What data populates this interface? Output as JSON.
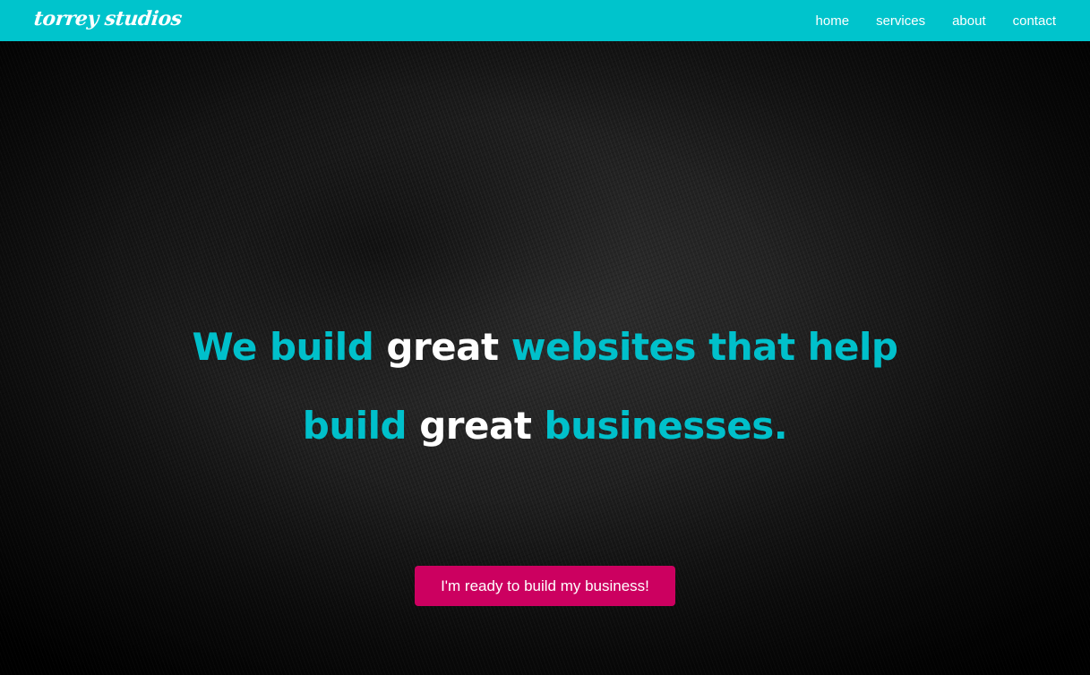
{
  "brand": {
    "logo_text": "torrey studios",
    "accent_color": "#00c4cc",
    "cta_color": "#cc0060"
  },
  "nav": {
    "items": [
      {
        "label": "home"
      },
      {
        "label": "services"
      },
      {
        "label": "about"
      },
      {
        "label": "contact"
      }
    ]
  },
  "hero": {
    "line1": [
      {
        "text": "We build ",
        "color": "cyan"
      },
      {
        "text": "great ",
        "color": "white"
      },
      {
        "text": "websites that help",
        "color": "cyan"
      }
    ],
    "line2": [
      {
        "text": "build ",
        "color": "cyan"
      },
      {
        "text": "great ",
        "color": "white"
      },
      {
        "text": "businesses.",
        "color": "cyan"
      }
    ],
    "cta_label": "I'm ready to build my business!"
  }
}
